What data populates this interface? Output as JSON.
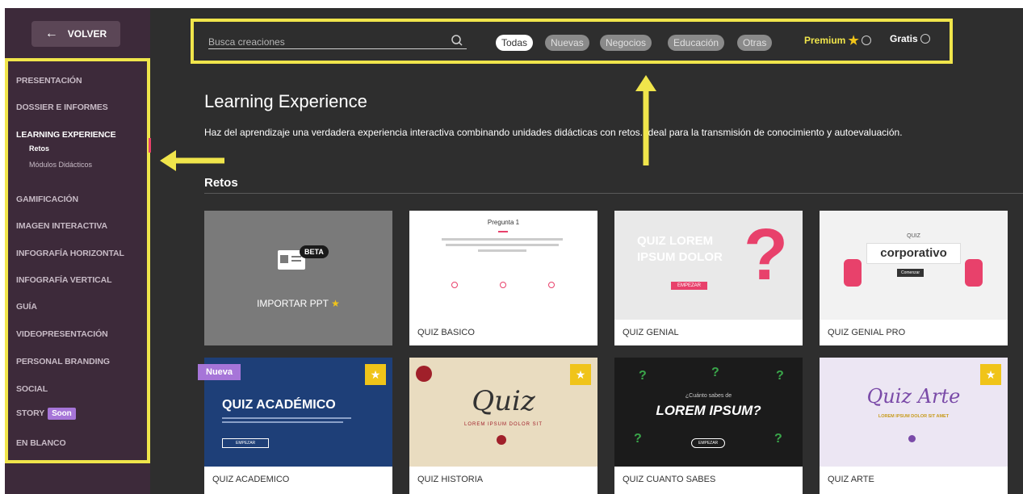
{
  "sidebar": {
    "back_label": "VOLVER",
    "items": [
      {
        "label": "PRESENTACIÓN"
      },
      {
        "label": "DOSSIER E INFORMES"
      },
      {
        "label": "LEARNING EXPERIENCE"
      },
      {
        "label": "GAMIFICACIÓN"
      },
      {
        "label": "IMAGEN INTERACTIVA"
      },
      {
        "label": "INFOGRAFÍA HORIZONTAL"
      },
      {
        "label": "INFOGRAFÍA VERTICAL"
      },
      {
        "label": "GUÍA"
      },
      {
        "label": "VIDEOPRESENTACIÓN"
      },
      {
        "label": "PERSONAL BRANDING"
      },
      {
        "label": "SOCIAL"
      },
      {
        "label": "STORY",
        "badge": "Soon"
      },
      {
        "label": "EN BLANCO"
      }
    ],
    "sub_items": [
      {
        "label": "Retos"
      },
      {
        "label": "Módulos Didácticos"
      }
    ]
  },
  "search": {
    "placeholder": "Busca creaciones"
  },
  "filters": {
    "chips": [
      "Todas",
      "Nuevas",
      "Negocios",
      "Educación",
      "Otras"
    ],
    "premium_label": "Premium",
    "gratis_label": "Gratis"
  },
  "main": {
    "title": "Learning Experience",
    "description": "Haz del aprendizaje una verdadera experiencia interactiva combinando unidades didácticas con retos. Ideal para la transmisión de conocimiento y autoevaluación.",
    "section_title": "Retos"
  },
  "cards": [
    {
      "label": "",
      "thumb_title": "IMPORTAR PPT",
      "beta": "BETA"
    },
    {
      "label": "QUIZ BASICO",
      "thumb_title": "Pregunta 1"
    },
    {
      "label": "QUIZ GENIAL",
      "thumb_title": "QUIZ LOREM IPSUM DOLOR",
      "thumb_button": "EMPEZAR"
    },
    {
      "label": "QUIZ GENIAL PRO",
      "thumb_title": "corporativo",
      "thumb_sub": "QUIZ",
      "thumb_button": "Comenzar"
    },
    {
      "label": "QUIZ ACADEMICO",
      "thumb_title": "QUIZ ACADÉMICO",
      "badge": "Nueva",
      "thumb_button": "EMPEZAR"
    },
    {
      "label": "QUIZ HISTORIA",
      "thumb_title": "Quiz",
      "thumb_sub": "LOREM IPSUM DOLOR SIT"
    },
    {
      "label": "QUIZ CUANTO SABES",
      "thumb_title": "LOREM IPSUM?",
      "thumb_sub": "¿Cuánto sabes de",
      "thumb_button": "EMPEZAR"
    },
    {
      "label": "QUIZ ARTE",
      "thumb_title": "Quiz Arte",
      "thumb_sub": "LOREM IPSUM DOLOR SIT AMET"
    }
  ],
  "colors": {
    "highlight": "#f0e54b",
    "sidebar_bg": "#3d2a3a",
    "main_bg": "#2e2e2e",
    "premium_star": "#f0c419",
    "nueva_badge": "#a675d8"
  }
}
